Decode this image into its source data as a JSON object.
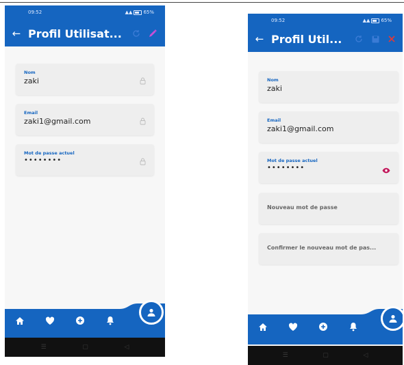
{
  "screens": [
    {
      "status": {
        "time": "09:52",
        "signal": "‡ ³⁴⁴ ⁙⅑",
        "battery": "65%"
      },
      "header": {
        "back_icon": "arrow-left-icon",
        "title": "Profil Utilisat...",
        "actions": [
          "refresh-icon",
          "edit-icon"
        ]
      },
      "fields": [
        {
          "label": "Nom",
          "value": "zaki",
          "icon": "lock-icon"
        },
        {
          "label": "Email",
          "value": "zaki1@gmail.com",
          "icon": "lock-icon"
        },
        {
          "label": "Mot de passe actuel",
          "value": "••••••••",
          "icon": "lock-icon"
        }
      ],
      "nav": [
        "home-icon",
        "heart-icon",
        "add-circle-icon",
        "bell-icon",
        "profile-icon"
      ]
    },
    {
      "status": {
        "time": "09:52",
        "battery": "65%"
      },
      "header": {
        "back_icon": "arrow-left-icon",
        "title": "Profil Util...",
        "actions": [
          "refresh-icon",
          "save-icon",
          "close-icon"
        ]
      },
      "fields": [
        {
          "label": "Nom",
          "value": "zaki"
        },
        {
          "label": "Email",
          "value": "zaki1@gmail.com"
        },
        {
          "label": "Mot de passe actuel",
          "value": "••••••••",
          "icon": "eye-icon"
        }
      ],
      "inputs": [
        {
          "placeholder": "Nouveau mot de passe"
        },
        {
          "placeholder": "Confirmer le nouveau mot de pas..."
        }
      ],
      "nav": [
        "home-icon",
        "heart-icon",
        "add-circle-icon",
        "bell-icon",
        "profile-icon"
      ]
    }
  ],
  "colors": {
    "primary": "#1565c0",
    "accent_edit": "#c94fd6",
    "close": "#e53935",
    "eye": "#c2185b"
  }
}
